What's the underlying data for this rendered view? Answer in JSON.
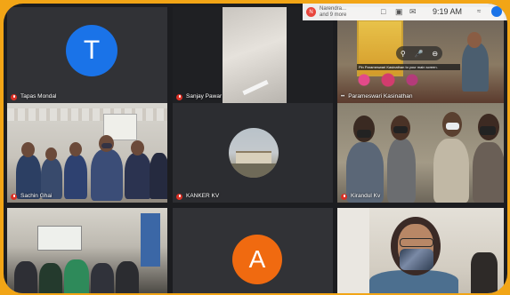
{
  "status_bar": {
    "notification_badge": "N",
    "notification_title": "Narendra...",
    "notification_more": "and 9 more",
    "time": "9:19 AM"
  },
  "participants": [
    {
      "name": "Tapas Mondal",
      "avatar_letter": "T",
      "avatar_color": "#1a73e8"
    },
    {
      "name": "Sanjay Pawar"
    },
    {
      "name": "Parameswari Kasinathan"
    },
    {
      "name": "Sachin Ghai"
    },
    {
      "name": "KANKER KV"
    },
    {
      "name": "Kirandul Kv"
    },
    {
      "name": ""
    },
    {
      "name": "",
      "avatar_letter": "A",
      "avatar_color": "#f06a10"
    },
    {
      "name": ""
    }
  ],
  "pin_tooltip": "Pin Parameswari Kasinathan to your main screen."
}
